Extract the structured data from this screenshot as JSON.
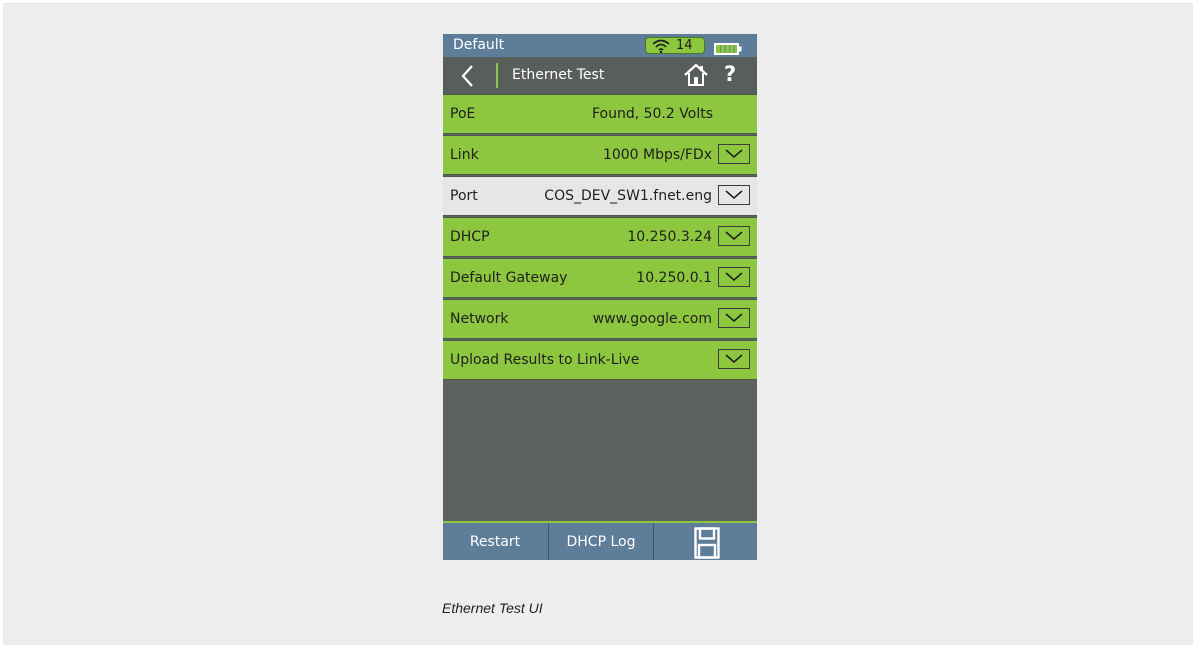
{
  "status": {
    "profile": "Default",
    "wifi_count": "14",
    "wifi_icon": "wifi-icon",
    "battery_icon": "battery-icon"
  },
  "nav": {
    "title": "Ethernet Test",
    "back_icon": "chevron-left-icon",
    "home_icon": "home-icon",
    "help_label": "?"
  },
  "rows": [
    {
      "label": "PoE",
      "value": "Found, 50.2 Volts",
      "status": "pass",
      "dropdown": false
    },
    {
      "label": "Link",
      "value": "1000 Mbps/FDx",
      "status": "pass",
      "dropdown": true
    },
    {
      "label": "Port",
      "value": "COS_DEV_SW1.fnet.eng",
      "status": "info",
      "dropdown": true
    },
    {
      "label": "DHCP",
      "value": "10.250.3.24",
      "status": "pass",
      "dropdown": true
    },
    {
      "label": "Default Gateway",
      "value": "10.250.0.1",
      "status": "pass",
      "dropdown": true
    },
    {
      "label": "Network",
      "value": "www.google.com",
      "status": "pass",
      "dropdown": true
    },
    {
      "label": "Upload Results to Link-Live",
      "value": "",
      "status": "pass",
      "dropdown": true
    }
  ],
  "bottom": {
    "restart_label": "Restart",
    "dhcp_log_label": "DHCP Log",
    "save_icon": "save-icon"
  },
  "caption": "Ethernet Test UI",
  "colors": {
    "pass_green": "#8dc63f",
    "header_blue": "#5d7d99",
    "nav_gray": "#5a5e5a",
    "body_gray": "#5e625e"
  }
}
